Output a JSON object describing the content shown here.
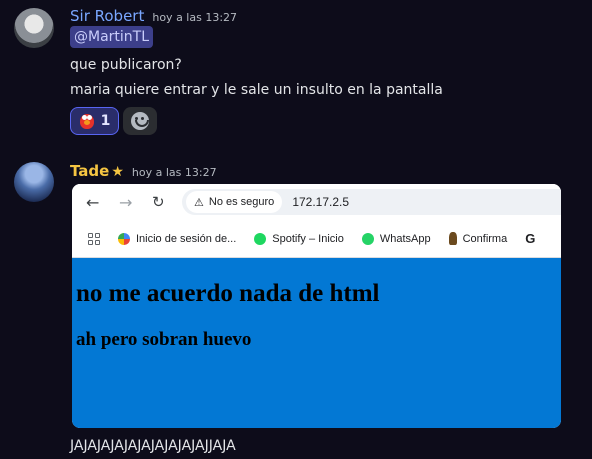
{
  "messages": [
    {
      "author": "Sir Robert",
      "timestamp": "hoy a las 13:27",
      "mention": "@MartinTL",
      "lines": [
        "que publicaron?",
        "maria quiere entrar y le sale un insulto en la pantalla"
      ],
      "reactions": [
        {
          "icon": "elmo-emoji",
          "count": "1"
        }
      ],
      "add_reaction_icon": "smile-icon"
    },
    {
      "author": "Tade",
      "author_badge": "★",
      "timestamp": "hoy a las 13:27",
      "attachment": {
        "browser": {
          "security_label": "No es seguro",
          "url": "172.17.2.5",
          "bookmarks": [
            {
              "icon": "google-g-icon",
              "label": "Inicio de sesión de..."
            },
            {
              "icon": "spotify-icon",
              "label": "Spotify – Inicio"
            },
            {
              "icon": "whatsapp-icon",
              "label": "WhatsApp"
            },
            {
              "icon": "confirma-icon",
              "label": "Confirma"
            }
          ]
        },
        "page": {
          "heading": "no me acuerdo nada de html",
          "subheading": "ah pero sobran huevo",
          "background": "#0378d4"
        }
      },
      "text_after": "JAJAJAJAJAJAJAJAJAJAJJAJA"
    }
  ],
  "colors": {
    "background": "#0d0c1a",
    "robert_name": "#7aa7ff",
    "tade_name": "#f5c542",
    "mention_bg": "#3c3f8a"
  }
}
